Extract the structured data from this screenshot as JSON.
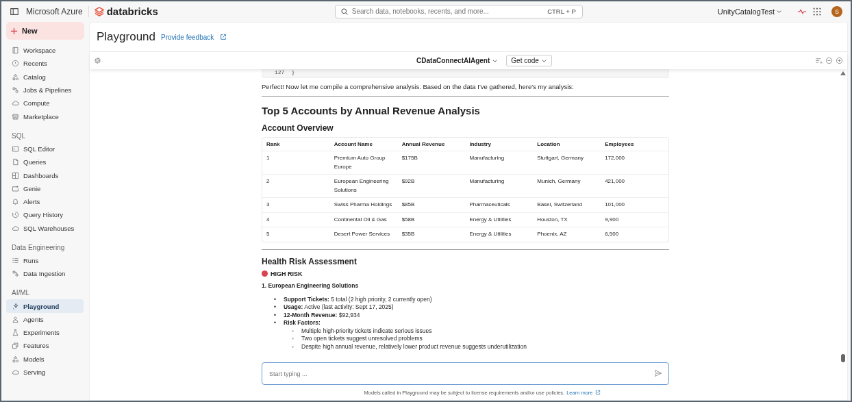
{
  "topbar": {
    "cloud": "Microsoft Azure",
    "brand": "databricks",
    "search": {
      "placeholder": "Search data, notebooks, recents, and more...",
      "shortcut": "CTRL + P"
    },
    "workspace": "UnityCatalogTest",
    "avatar": "S"
  },
  "sidebar": {
    "new_button": "New",
    "sections": [
      {
        "items": [
          {
            "label": "Workspace",
            "kind": "panel",
            "selected": false
          },
          {
            "label": "Recents",
            "kind": "clock",
            "selected": false
          },
          {
            "label": "Catalog",
            "kind": "shapes",
            "selected": false
          },
          {
            "label": "Jobs & Pipelines",
            "kind": "flow",
            "selected": false
          },
          {
            "label": "Compute",
            "kind": "cloud",
            "selected": false
          },
          {
            "label": "Marketplace",
            "kind": "store",
            "selected": false
          }
        ]
      },
      {
        "title": "SQL",
        "items": [
          {
            "label": "SQL Editor",
            "kind": "terminal",
            "selected": false
          },
          {
            "label": "Queries",
            "kind": "document",
            "selected": false
          },
          {
            "label": "Dashboards",
            "kind": "grid",
            "selected": false
          },
          {
            "label": "Genie",
            "kind": "chat",
            "selected": false
          },
          {
            "label": "Alerts",
            "kind": "bell",
            "selected": false
          },
          {
            "label": "Query History",
            "kind": "history",
            "selected": false
          },
          {
            "label": "SQL Warehouses",
            "kind": "cloud",
            "selected": false
          }
        ]
      },
      {
        "title": "Data Engineering",
        "items": [
          {
            "label": "Runs",
            "kind": "list",
            "selected": false
          },
          {
            "label": "Data Ingestion",
            "kind": "flow",
            "selected": false
          }
        ]
      },
      {
        "title": "AI/ML",
        "items": [
          {
            "label": "Playground",
            "kind": "sparkle",
            "selected": true
          },
          {
            "label": "Agents",
            "kind": "person",
            "selected": false
          },
          {
            "label": "Experiments",
            "kind": "flask",
            "selected": false
          },
          {
            "label": "Features",
            "kind": "stack",
            "selected": false
          },
          {
            "label": "Models",
            "kind": "shapes",
            "selected": false
          },
          {
            "label": "Serving",
            "kind": "cloud",
            "selected": false
          }
        ]
      }
    ]
  },
  "page": {
    "title": "Playground",
    "feedback_link": "Provide feedback"
  },
  "toolbar": {
    "agent": "CDataConnectAIAgent",
    "get_code": "Get code"
  },
  "response": {
    "code_tail": {
      "line_number": "127",
      "code": "}"
    },
    "intro": "Perfect! Now let me compile a comprehensive analysis. Based on the data I've gathered, here's my analysis:",
    "heading": "Top 5 Accounts by Annual Revenue Analysis",
    "table_heading": "Account Overview",
    "table": {
      "columns": [
        "Rank",
        "Account Name",
        "Annual Revenue",
        "Industry",
        "Location",
        "Employees"
      ],
      "rows": [
        [
          "1",
          "Premium Auto Group Europe",
          "$175B",
          "Manufacturing",
          "Stuttgart, Germany",
          "172,000"
        ],
        [
          "2",
          "European Engineering Solutions",
          "$92B",
          "Manufacturing",
          "Munich, Germany",
          "421,000"
        ],
        [
          "3",
          "Swiss Pharma Holdings",
          "$85B",
          "Pharmaceuticals",
          "Basel, Switzerland",
          "101,000"
        ],
        [
          "4",
          "Continental Oil & Gas",
          "$58B",
          "Energy & Utilities",
          "Houston, TX",
          "9,900"
        ],
        [
          "5",
          "Desert Power Services",
          "$35B",
          "Energy & Utilities",
          "Phoenix, AZ",
          "6,500"
        ]
      ]
    },
    "risk_heading": "Health Risk Assessment",
    "risk_level": {
      "label": "HIGH RISK",
      "color": "#d9434f"
    },
    "account": "1. European Engineering Solutions",
    "facts": [
      {
        "marker": "•",
        "text": "**Support Tickets:** 5 total (2 high priority, 2 currently open)"
      },
      {
        "marker": "•",
        "text": "**Usage:** Active (last activity: Sept 17, 2025)"
      },
      {
        "marker": "•",
        "text": "**12-Month Revenue:** $92,934"
      },
      {
        "marker": "•",
        "text": "**Risk Factors:**",
        "children": [
          {
            "marker": "◦",
            "text": "Multiple high-priority tickets indicate serious issues"
          },
          {
            "marker": "◦",
            "text": "Two open tickets suggest unresolved problems"
          },
          {
            "marker": "◦",
            "text": "Despite high annual revenue, relatively lower product revenue suggests underutilization"
          }
        ]
      }
    ]
  },
  "composer": {
    "placeholder": "Start typing ..."
  },
  "footer": {
    "text": "Models called in Playground may be subject to license requirements and/or use policies.",
    "link": "Learn more"
  }
}
